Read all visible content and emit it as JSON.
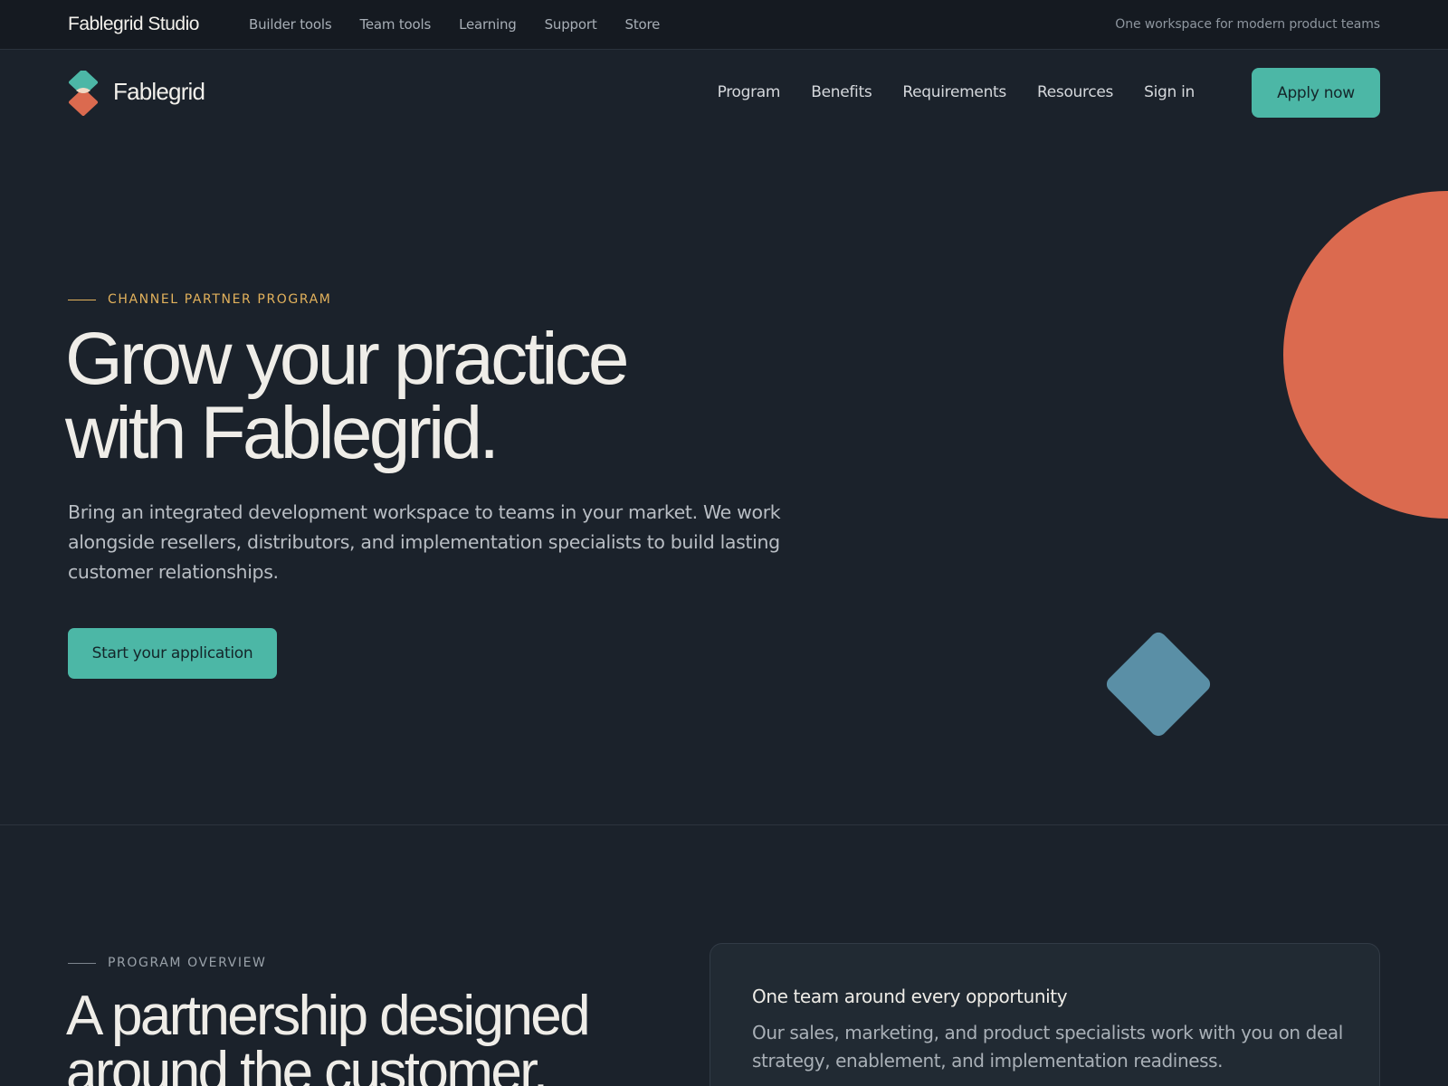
{
  "topbar": {
    "brand": "Fablegrid Studio",
    "links": [
      "Builder tools",
      "Team tools",
      "Learning",
      "Support",
      "Store"
    ],
    "tagline": "One workspace for modern product teams"
  },
  "header": {
    "brand_name": "Fablegrid",
    "nav": [
      "Program",
      "Benefits",
      "Requirements",
      "Resources",
      "Sign in"
    ],
    "apply_label": "Apply now"
  },
  "hero": {
    "eyebrow": "CHANNEL PARTNER PROGRAM",
    "title_lines": [
      "Grow your practice",
      "with Fablegrid."
    ],
    "subtitle": "Bring an integrated development workspace to teams in your market. We work alongside resellers, distributors, and implementation specialists to build lasting customer relationships.",
    "cta_label": "Start your application"
  },
  "overview": {
    "eyebrow": "PROGRAM OVERVIEW",
    "title_lines": [
      "A partnership designed",
      "around the customer."
    ],
    "card": {
      "title": "One team around every opportunity",
      "body": "Our sales, marketing, and product specialists work with you on deal strategy, enablement, and implementation readiness."
    }
  },
  "colors": {
    "background": "#1b222b",
    "topbar": "#151a21",
    "accent_teal": "#4cb7a6",
    "accent_coral": "#db6a4f",
    "accent_gold": "#e3b25c",
    "accent_steel": "#5a8fa6"
  },
  "icons": {
    "logo": "fablegrid-logo-icon"
  }
}
